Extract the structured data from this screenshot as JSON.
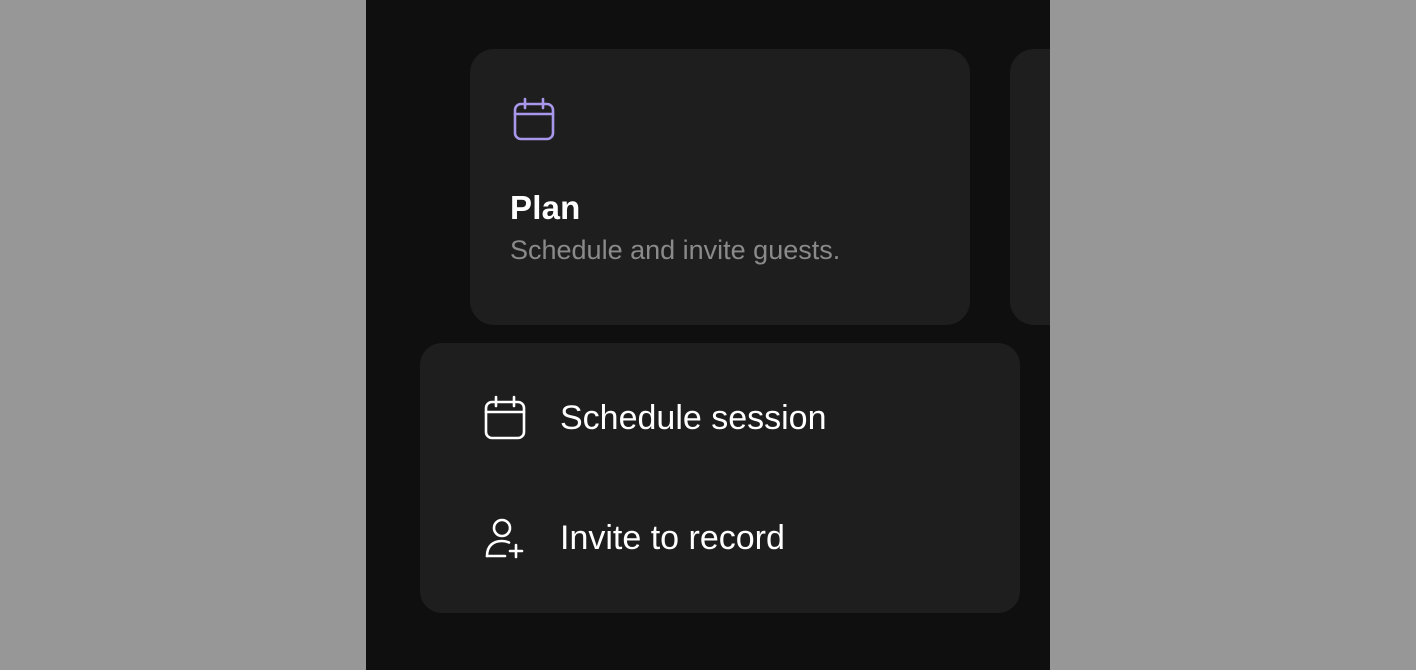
{
  "colors": {
    "backdrop": "#979797",
    "window_bg": "#0f0f0f",
    "card_bg": "#1e1e1e",
    "accent_icon": "#a897ea",
    "text_primary": "#ffffff",
    "text_secondary": "#8a8a8a"
  },
  "plan_card": {
    "icon": "calendar-icon",
    "title": "Plan",
    "subtitle": "Schedule and invite guests."
  },
  "menu": {
    "items": [
      {
        "icon": "calendar-icon",
        "label": "Schedule session"
      },
      {
        "icon": "user-plus-icon",
        "label": "Invite to record"
      }
    ]
  }
}
